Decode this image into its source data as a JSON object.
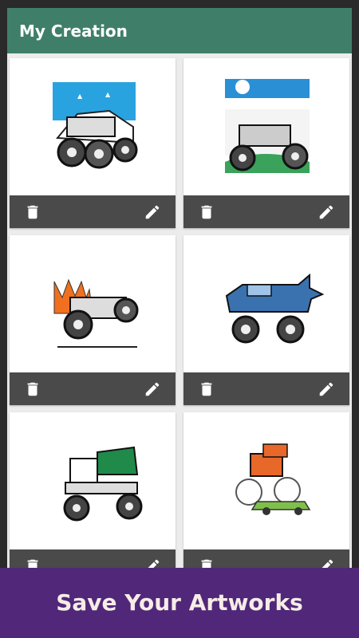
{
  "appbar": {
    "title": "My Creation",
    "color": "#3f7f69"
  },
  "cards": [
    {
      "name": "monster-truck-sky",
      "bg": "#29a3e0",
      "ground": "#ffffff"
    },
    {
      "name": "monster-truck-stadium",
      "bg": "#2b8fd6",
      "ground": "#3aa25a"
    },
    {
      "name": "monster-truck-flames",
      "bg": "#ffffff",
      "ground": "#ffffff"
    },
    {
      "name": "monster-truck-shark",
      "bg": "#ffffff",
      "ground": "#ffffff"
    },
    {
      "name": "monster-truck-green",
      "bg": "#ffffff",
      "ground": "#ffffff"
    },
    {
      "name": "monster-truck-crushing-car",
      "bg": "#ffffff",
      "ground": "#ffffff"
    }
  ],
  "icons": {
    "delete": "trash-icon",
    "edit": "pencil-icon"
  },
  "banner": {
    "text": "Save Your Artworks",
    "color": "#51277a"
  }
}
